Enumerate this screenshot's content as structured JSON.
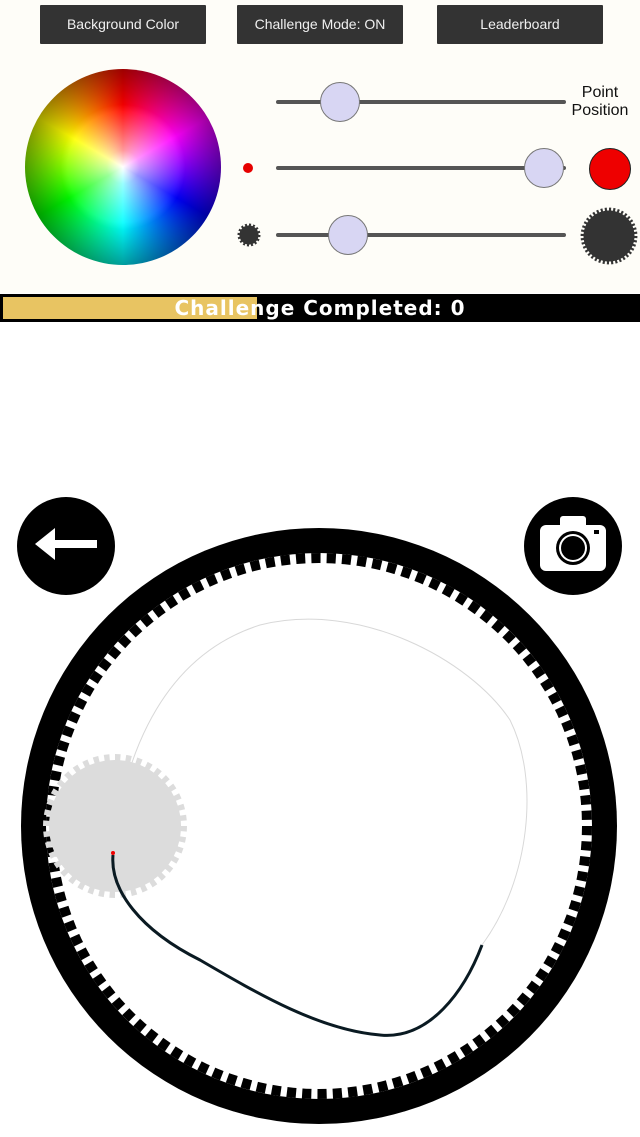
{
  "toolbar": {
    "background_color_label": "Background Color",
    "challenge_mode_label": "Challenge Mode: ON",
    "leaderboard_label": "Leaderboard"
  },
  "controls": {
    "point_position_label": "Point\nPosition",
    "point_position_value": 0.22,
    "point_size_value": 0.93,
    "gear_size_value": 0.25,
    "point_color": "#ee0000",
    "gear_color": "#333333"
  },
  "progress": {
    "text": "Challenge Completed: 0",
    "fill_fraction": 0.4,
    "fill_color": "#e8c462"
  },
  "icons": {
    "back": "arrow-left-icon",
    "camera": "camera-icon"
  }
}
